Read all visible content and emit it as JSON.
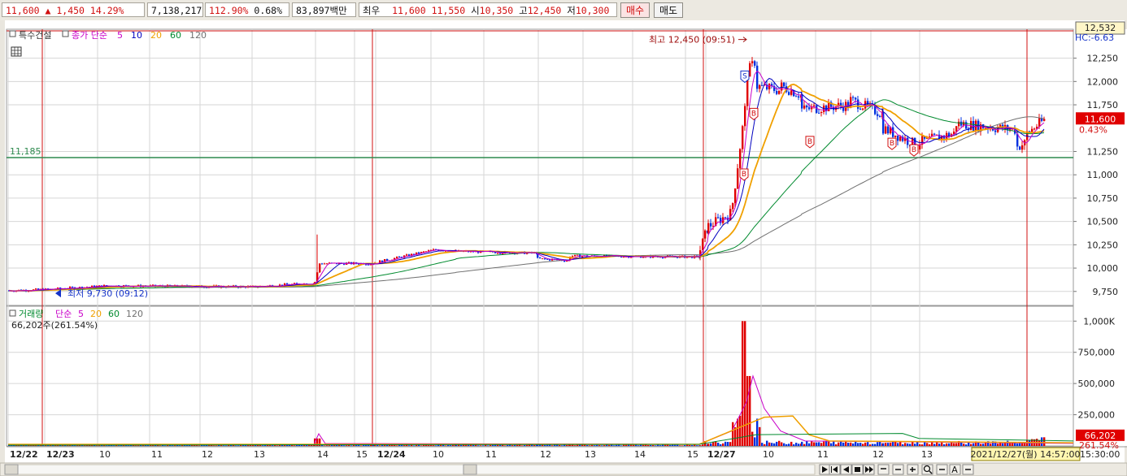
{
  "quote": {
    "price": "11,600",
    "arrow": "▲",
    "change": "1,450",
    "change_pct": "14.29%",
    "volume": "7,138,217",
    "vol_ratio": "112.90%",
    "turnover": "0.68%",
    "amount": "83,897백만",
    "bid_label": "최우",
    "ask_best": "11,600",
    "bid_best": "11,550",
    "open_label": "시",
    "open": "10,350",
    "high_label": "고",
    "high": "12,450",
    "low_label": "저",
    "low": "10,300"
  },
  "buttons": {
    "buy": "매수",
    "sell": "매도"
  },
  "price_panel": {
    "legend_special": "특수건설",
    "legend_ma": "종가 단순",
    "ma_periods": [
      "5",
      "10",
      "20",
      "60",
      "120"
    ],
    "hc_label": "HC:-6.63",
    "high_marker": "최고 12,450 (09:51)",
    "low_marker": "최저 9,730 (09:12)",
    "hline_label": "11,185",
    "current_price_box": "11,600",
    "current_pct": "0.43%",
    "top_box": "12,532"
  },
  "volume_panel": {
    "legend_title": "거래량",
    "legend_ma": "단순",
    "ma_periods": [
      "5",
      "20",
      "60",
      "120"
    ],
    "current_text": "66,202주(261.54%)",
    "vol_box": "66,202",
    "vol_pct": "261.54%"
  },
  "y_axis_price": [
    "12,250",
    "12,000",
    "11,750",
    "11,250",
    "11,000",
    "10,750",
    "10,500",
    "10,250",
    "10,000",
    "9,750"
  ],
  "y_axis_volume": [
    "1,000K",
    "750,000",
    "500,000",
    "250,000"
  ],
  "x_axis": [
    "12/22",
    "12/23",
    "10",
    "11",
    "12",
    "13",
    "14",
    "15",
    "12/24",
    "10",
    "11",
    "12",
    "13",
    "14",
    "15",
    "12/27",
    "10",
    "11",
    "12",
    "13",
    "15:30:00"
  ],
  "timestamp": "2021/12/27(월) 14:57:00",
  "nav_icons": [
    "play-right-icon",
    "rewind-icon",
    "back-icon",
    "stop-icon",
    "forward-icon",
    "zoom-bar-icon",
    "zoom-out-icon",
    "zoom-in-icon",
    "search-icon",
    "minus-icon",
    "text-tool-icon",
    "minimize-icon"
  ],
  "colors": {
    "up": "#e00000",
    "down": "#0030e0",
    "ma5": "#c800c8",
    "ma10": "#0000c0",
    "ma20": "#f0a000",
    "ma60": "#008a2e",
    "ma120": "#707070",
    "hline": "#2d8a4e",
    "grid": "#d6d6d6"
  }
}
